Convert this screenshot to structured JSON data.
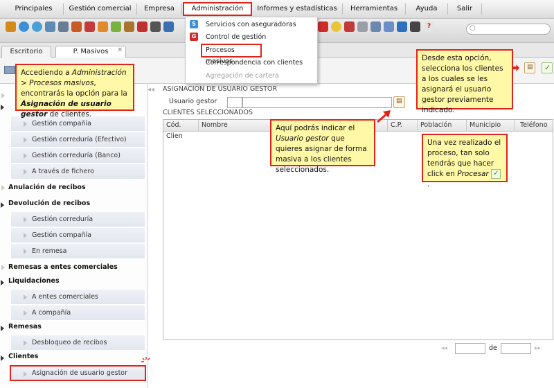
{
  "menubar": {
    "items": [
      "Principales",
      "Gestión comercial",
      "Empresa",
      "Administración",
      "Informes y estadísticas",
      "Herramientas",
      "Ayuda",
      "Salir"
    ],
    "active": "Administración"
  },
  "dropdown": {
    "items": [
      {
        "label": "Servicios con aseguradoras",
        "icon": "servicios-icon"
      },
      {
        "label": "Control de gestión",
        "icon": "control-gestion-icon"
      },
      {
        "label": "Procesos masivos",
        "icon": ""
      },
      {
        "label": "Correspondencia con clientes",
        "icon": ""
      },
      {
        "label": "Agregación de cartera",
        "icon": "",
        "disabled": true
      }
    ]
  },
  "tabs": [
    {
      "label": "Escritorio"
    },
    {
      "label": "P. Masivos",
      "close": "×"
    }
  ],
  "sidebar": {
    "items": [
      {
        "label": "",
        "type": "group"
      },
      {
        "label": "Gestión compañía",
        "type": "sub"
      },
      {
        "label": "Gestión correduría (Efectivo)",
        "type": "sub"
      },
      {
        "label": "Gestión correduría (Banco)",
        "type": "sub"
      },
      {
        "label": "A través de fichero",
        "type": "sub"
      },
      {
        "label": "Anulación de recibos",
        "type": "group-collapsed"
      },
      {
        "label": "Devolución de recibos",
        "type": "group"
      },
      {
        "label": "Gestión correduría",
        "type": "sub"
      },
      {
        "label": "Gestión compañía",
        "type": "sub"
      },
      {
        "label": "En remesa",
        "type": "sub"
      },
      {
        "label": "Remesas a entes comerciales",
        "type": "group-collapsed"
      },
      {
        "label": "Liquidaciones",
        "type": "group"
      },
      {
        "label": "A entes comerciales",
        "type": "sub"
      },
      {
        "label": "A compañía",
        "type": "sub"
      },
      {
        "label": "Remesas",
        "type": "group"
      },
      {
        "label": "Desbloqueo de recibos",
        "type": "sub"
      },
      {
        "label": "Clientes",
        "type": "group"
      },
      {
        "label": "Asignación de usuario gestor",
        "type": "sub",
        "selected": true
      }
    ]
  },
  "main": {
    "section_title": "ASIGNACIÓN DE USUARIO GESTOR",
    "usuario_gestor_label": "Usuario gestor",
    "clientes_title": "CLIENTES SELECCIONADOS",
    "columns": [
      "Cód. Clien",
      "Nombre",
      "C.P.",
      "Población",
      "Municipio",
      "Teléfono"
    ]
  },
  "pagination": {
    "of_label": "de"
  },
  "callouts": {
    "c1": {
      "p1": "Accediendo a ",
      "i1": "Administración > Procesos masivos",
      "p2": ", encontrarás la opción para la ",
      "b1": "Asignación de usuario gestor",
      "p3": " de clientes."
    },
    "c2": {
      "p1": "Desde esta opción, selecciona los clientes a los cuales se les asignará el usuario gestor previamente indicado."
    },
    "c3": {
      "p1": "Aquí podrás indicar el ",
      "i1": "Usuario gestor",
      "p2": " que quieres asignar de forma masiva a los clientes seleccionados."
    },
    "c4": {
      "p1": "Una vez realizado el proceso, tan solo tendrás que hacer click en ",
      "i1": "Procesar",
      "p2": "."
    }
  },
  "colors": {
    "highlight": "#e2231a",
    "callout_bg": "#fff8a6",
    "accept": "#5aa02c"
  }
}
